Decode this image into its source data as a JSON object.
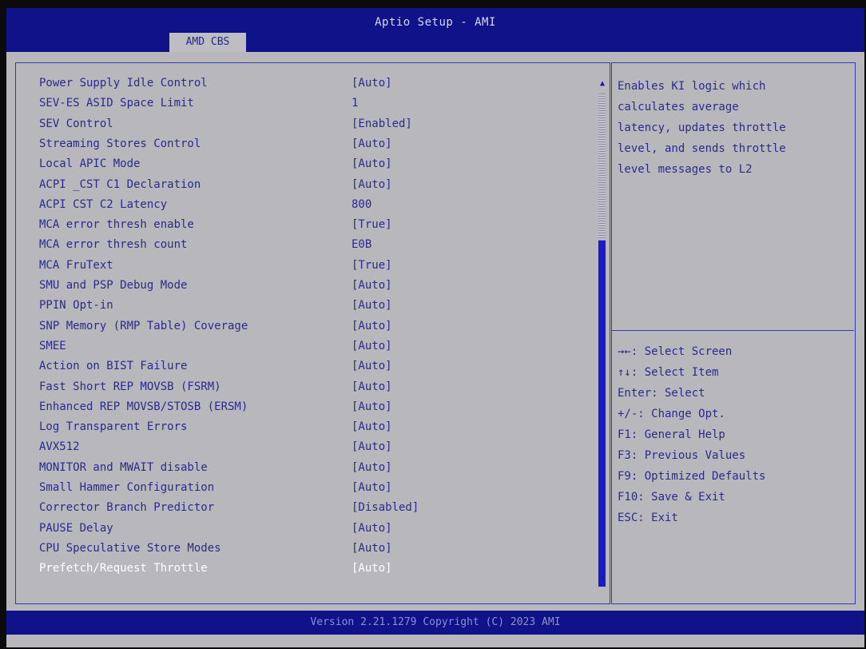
{
  "header": {
    "title": "Aptio Setup - AMI",
    "active_tab": "AMD CBS"
  },
  "settings": [
    {
      "label": "Power Supply Idle Control",
      "value": "[Auto]"
    },
    {
      "label": "SEV-ES ASID Space Limit",
      "value": "1"
    },
    {
      "label": "SEV Control",
      "value": "[Enabled]"
    },
    {
      "label": "Streaming Stores Control",
      "value": "[Auto]"
    },
    {
      "label": "Local APIC Mode",
      "value": "[Auto]"
    },
    {
      "label": "ACPI _CST C1 Declaration",
      "value": "[Auto]"
    },
    {
      "label": "ACPI CST C2 Latency",
      "value": "800"
    },
    {
      "label": "MCA error thresh enable",
      "value": "[True]"
    },
    {
      "label": "MCA error thresh count",
      "value": "E0B"
    },
    {
      "label": "MCA FruText",
      "value": "[True]"
    },
    {
      "label": "SMU and PSP Debug Mode",
      "value": "[Auto]"
    },
    {
      "label": "PPIN Opt-in",
      "value": "[Auto]"
    },
    {
      "label": "SNP Memory (RMP Table) Coverage",
      "value": "[Auto]"
    },
    {
      "label": "SMEE",
      "value": "[Auto]"
    },
    {
      "label": "Action on BIST Failure",
      "value": "[Auto]"
    },
    {
      "label": "Fast Short REP MOVSB (FSRM)",
      "value": "[Auto]"
    },
    {
      "label": "Enhanced REP MOVSB/STOSB (ERSM)",
      "value": "[Auto]"
    },
    {
      "label": "Log Transparent Errors",
      "value": "[Auto]"
    },
    {
      "label": "AVX512",
      "value": "[Auto]"
    },
    {
      "label": "MONITOR and MWAIT disable",
      "value": "[Auto]"
    },
    {
      "label": "Small Hammer Configuration",
      "value": "[Auto]"
    },
    {
      "label": "Corrector Branch Predictor",
      "value": "[Disabled]"
    },
    {
      "label": "PAUSE Delay",
      "value": "[Auto]"
    },
    {
      "label": "CPU Speculative Store Modes",
      "value": "[Auto]"
    },
    {
      "label": "Prefetch/Request Throttle",
      "value": "[Auto]"
    }
  ],
  "selected_index": 24,
  "help": {
    "description_lines": [
      "Enables KI logic which",
      "calculates average",
      "latency, updates throttle",
      "level, and sends throttle",
      "level messages to L2"
    ],
    "keys": [
      "→←: Select Screen",
      "↑↓: Select Item",
      "Enter: Select",
      "+/-: Change Opt.",
      "F1: General Help",
      "F3: Previous Values",
      "F9: Optimized Defaults",
      "F10: Save & Exit",
      "ESC: Exit"
    ]
  },
  "scrollbar": {
    "up_icon": "▲",
    "down_icon": "▼",
    "position_fraction": 1.0
  },
  "footer": {
    "text": "Version 2.21.1279 Copyright (C) 2023 AMI"
  },
  "colors": {
    "header_bg": "#10128a",
    "body_bg": "#b8b8bc",
    "text": "#2a2a8e",
    "highlight_text": "#ffffff",
    "border": "#2f3bb0",
    "scroll_thumb": "#1a1acb"
  }
}
